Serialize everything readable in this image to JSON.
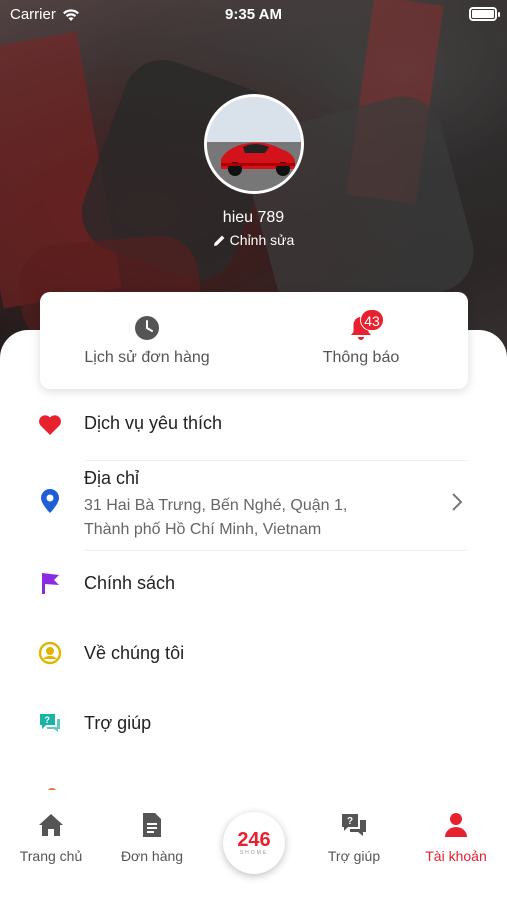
{
  "status_bar": {
    "carrier": "Carrier",
    "time": "9:35 AM"
  },
  "profile": {
    "username": "hieu 789",
    "edit_label": "Chỉnh sửa"
  },
  "quick_actions": {
    "order_history": "Lịch sử đơn hàng",
    "notifications": "Thông báo",
    "notification_count": "43"
  },
  "menu": {
    "favorites": "Dịch vụ yêu thích",
    "address_title": "Địa chỉ",
    "address_line1": "31 Hai Bà Trưng, Bến Nghé, Quận 1,",
    "address_line2": "Thành phố Hồ Chí Minh, Vietnam",
    "policy": "Chính sách",
    "about": "Về chúng tôi",
    "help": "Trợ giúp"
  },
  "tabbar": {
    "home": "Trang chủ",
    "orders": "Đơn hàng",
    "center_number": "246",
    "center_sub": "SHOME",
    "help": "Trợ giúp",
    "account": "Tài khoản"
  },
  "colors": {
    "accent": "#e8212e",
    "favorite": "#e8212e",
    "location": "#1e5fd6",
    "policy": "#8a2be2",
    "about": "#e0b400",
    "help": "#1bb3a6"
  }
}
